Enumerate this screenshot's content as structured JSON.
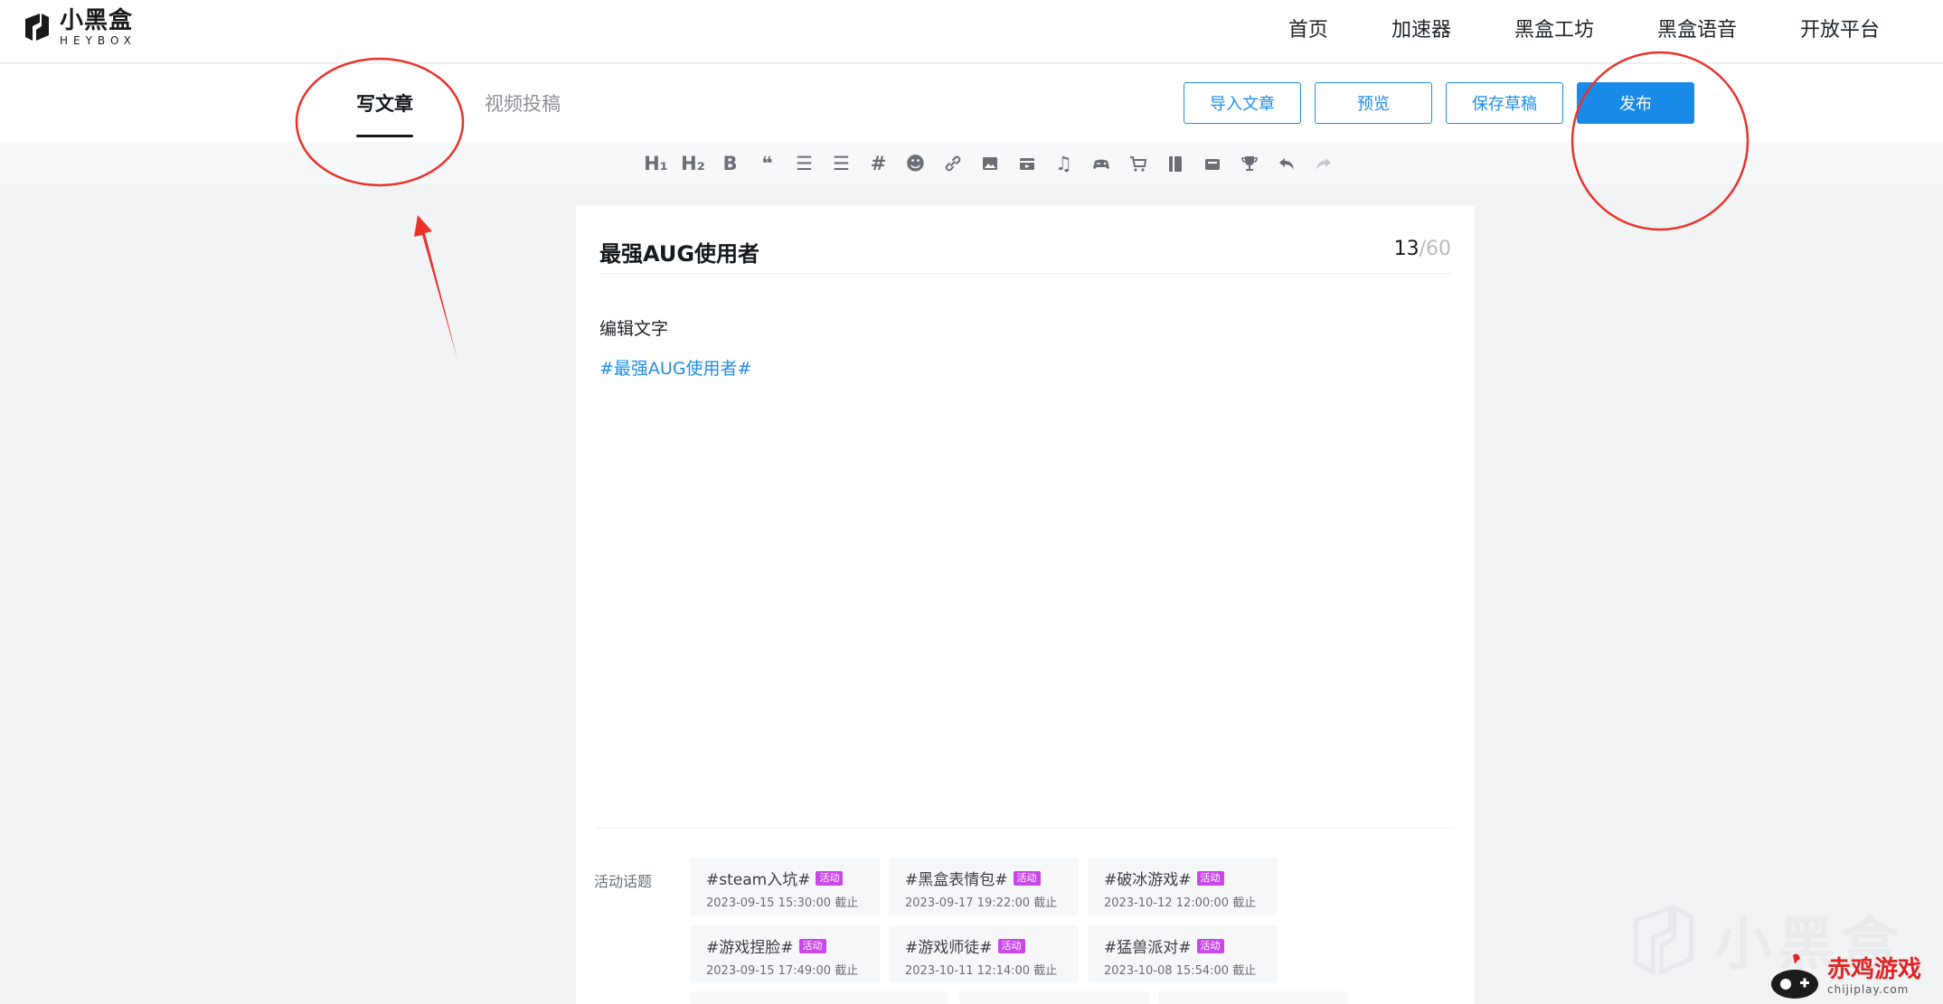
{
  "brand": {
    "name_cn": "小黑盒",
    "name_en": "HEYBOX"
  },
  "nav": [
    {
      "label": "首页"
    },
    {
      "label": "加速器"
    },
    {
      "label": "黑盒工坊"
    },
    {
      "label": "黑盒语音"
    },
    {
      "label": "开放平台"
    }
  ],
  "editor_tabs": {
    "write": "写文章",
    "video": "视频投稿"
  },
  "actions": {
    "import": "导入文章",
    "preview": "预览",
    "save": "保存草稿",
    "publish": "发布"
  },
  "toolbar": [
    {
      "icon": "heading-1-icon",
      "glyph": "H₁"
    },
    {
      "icon": "heading-2-icon",
      "glyph": "H₂"
    },
    {
      "icon": "bold-icon",
      "glyph": "B"
    },
    {
      "icon": "quote-icon",
      "glyph": "❝"
    },
    {
      "icon": "ordered-list-icon",
      "glyph": "☰"
    },
    {
      "icon": "bullet-list-icon",
      "glyph": "☰"
    },
    {
      "icon": "hashtag-icon",
      "glyph": "#"
    },
    {
      "icon": "emoji-icon",
      "glyph": "☻"
    },
    {
      "icon": "link-icon",
      "glyph": "🔗"
    },
    {
      "icon": "image-icon",
      "glyph": "▣"
    },
    {
      "icon": "video-icon",
      "glyph": "▤"
    },
    {
      "icon": "music-icon",
      "glyph": "♫"
    },
    {
      "icon": "game-icon",
      "glyph": "🎮"
    },
    {
      "icon": "cart-icon",
      "glyph": "🛒"
    },
    {
      "icon": "book-icon",
      "glyph": "▥"
    },
    {
      "icon": "box-icon",
      "glyph": "▦"
    },
    {
      "icon": "trophy-icon",
      "glyph": "🏆"
    },
    {
      "icon": "undo-icon",
      "glyph": "↶"
    },
    {
      "icon": "redo-icon",
      "glyph": "↷"
    }
  ],
  "article": {
    "title": "最强AUG使用者",
    "count_current": "13",
    "count_max": "/60",
    "body": "编辑文字",
    "hashtag": "#最强AUG使用者#"
  },
  "topics": {
    "label": "活动话题",
    "badge": "活动",
    "items": [
      {
        "name": "#steam入坑#",
        "deadline": "2023-09-15 15:30:00 截止"
      },
      {
        "name": "#黑盒表情包#",
        "deadline": "2023-09-17 19:22:00 截止"
      },
      {
        "name": "#破冰游戏#",
        "deadline": "2023-10-12 12:00:00 截止"
      },
      {
        "name": "#游戏捏脸#",
        "deadline": "2023-09-15 17:49:00 截止"
      },
      {
        "name": "#游戏师徒#",
        "deadline": "2023-10-11 12:14:00 截止"
      },
      {
        "name": "#猛兽派对#",
        "deadline": "2023-10-08 15:54:00 截止"
      }
    ]
  },
  "watermarks": {
    "heybox": "小黑盒",
    "chiji_cn": "赤鸡游戏",
    "chiji_en": "chijiplay.com"
  },
  "colors": {
    "accent": "#1a8ae8",
    "badge": "#c948e8",
    "annotation": "#e8332a"
  }
}
